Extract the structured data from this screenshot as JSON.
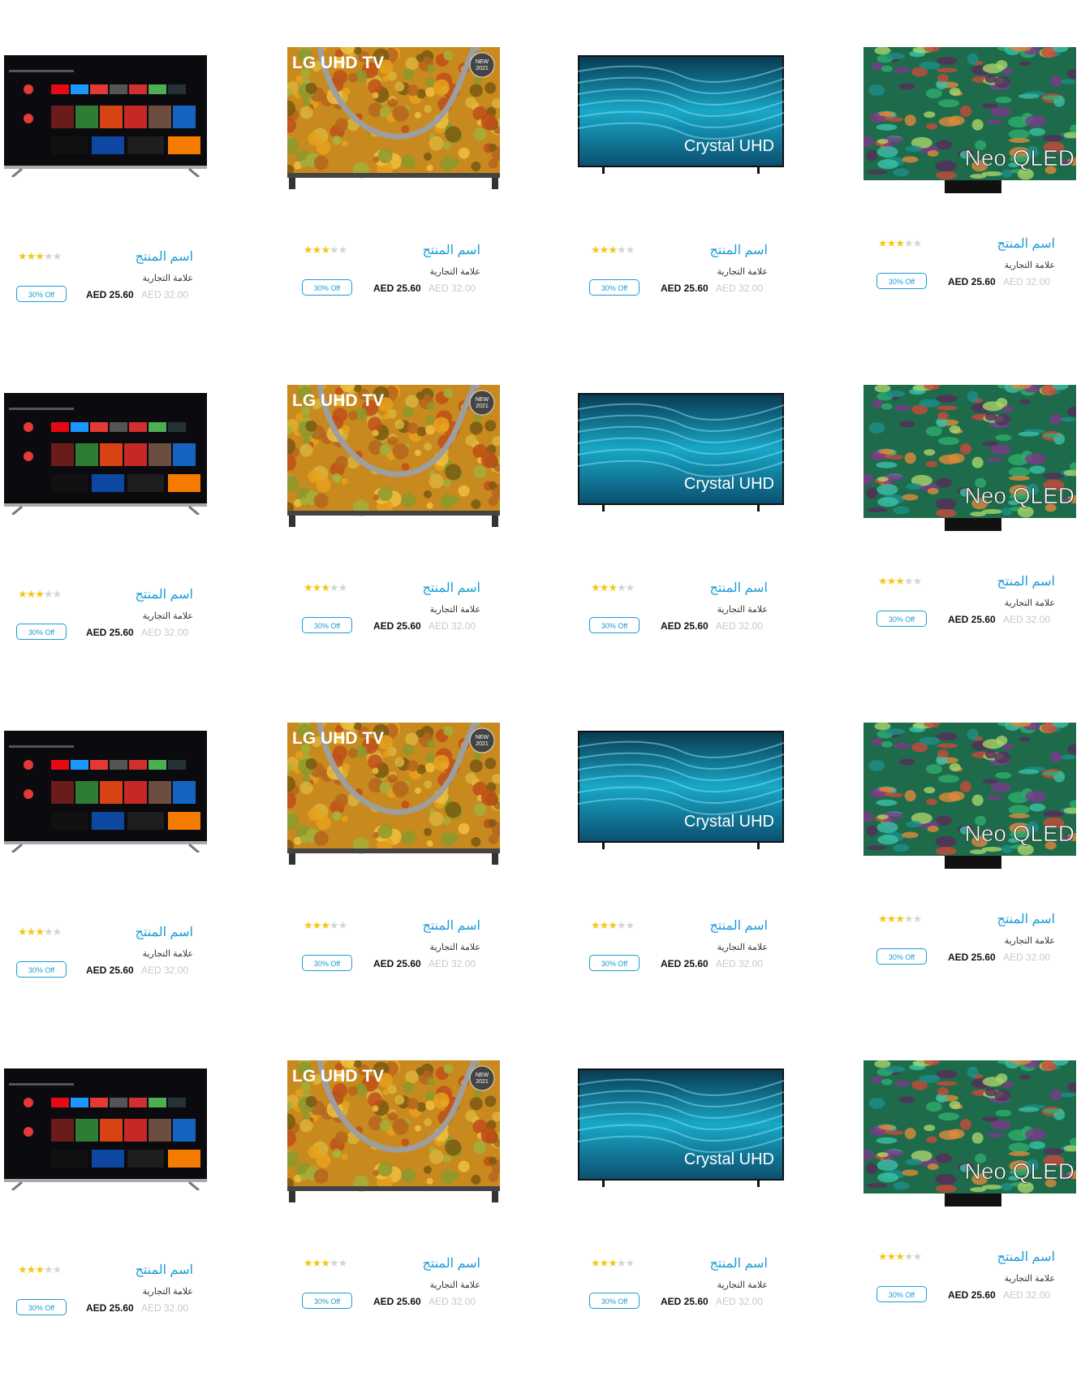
{
  "images": [
    {
      "type": "android-tv",
      "icon": "android-tv-screen-icon"
    },
    {
      "type": "lg-uhd",
      "brand_text": "LG UHD TV",
      "badge_line1": "NEW",
      "badge_line2": "2021",
      "icon": "lg-forest-screen-icon"
    },
    {
      "type": "crystal",
      "brand_text": "Crystal UHD",
      "icon": "crystal-wave-screen-icon"
    },
    {
      "type": "neo",
      "brand_text": "Neo QLED",
      "icon": "neo-abstract-screen-icon"
    }
  ],
  "products": [
    {
      "name": "اسم المنتج",
      "brand": "علامة التجارية",
      "rating": 3,
      "discount": "30% Off",
      "price": "AED 25.60",
      "old_price": "AED 32.00"
    },
    {
      "name": "اسم المنتج",
      "brand": "علامة التجارية",
      "rating": 3,
      "discount": "30% Off",
      "price": "AED 25.60",
      "old_price": "AED 32.00"
    },
    {
      "name": "اسم المنتج",
      "brand": "علامة التجارية",
      "rating": 3,
      "discount": "30% Off",
      "price": "AED 25.60",
      "old_price": "AED 32.00"
    },
    {
      "name": "اسم المنتج",
      "brand": "علامة التجارية",
      "rating": 3,
      "discount": "30% Off",
      "price": "AED 25.60",
      "old_price": "AED 32.00"
    },
    {
      "name": "اسم المنتج",
      "brand": "علامة التجارية",
      "rating": 3,
      "discount": "30% Off",
      "price": "AED 25.60",
      "old_price": "AED 32.00"
    },
    {
      "name": "اسم المنتج",
      "brand": "علامة التجارية",
      "rating": 3,
      "discount": "30% Off",
      "price": "AED 25.60",
      "old_price": "AED 32.00"
    },
    {
      "name": "اسم المنتج",
      "brand": "علامة التجارية",
      "rating": 3,
      "discount": "30% Off",
      "price": "AED 25.60",
      "old_price": "AED 32.00"
    },
    {
      "name": "اسم المنتج",
      "brand": "علامة التجارية",
      "rating": 3,
      "discount": "30% Off",
      "price": "AED 25.60",
      "old_price": "AED 32.00"
    },
    {
      "name": "اسم المنتج",
      "brand": "علامة التجارية",
      "rating": 3,
      "discount": "30% Off",
      "price": "AED 25.60",
      "old_price": "AED 32.00"
    },
    {
      "name": "اسم المنتج",
      "brand": "علامة التجارية",
      "rating": 3,
      "discount": "30% Off",
      "price": "AED 25.60",
      "old_price": "AED 32.00"
    },
    {
      "name": "اسم المنتج",
      "brand": "علامة التجارية",
      "rating": 3,
      "discount": "30% Off",
      "price": "AED 25.60",
      "old_price": "AED 32.00"
    },
    {
      "name": "اسم المنتج",
      "brand": "علامة التجارية",
      "rating": 3,
      "discount": "30% Off",
      "price": "AED 25.60",
      "old_price": "AED 32.00"
    },
    {
      "name": "اسم المنتج",
      "brand": "علامة التجارية",
      "rating": 3,
      "discount": "30% Off",
      "price": "AED 25.60",
      "old_price": "AED 32.00"
    },
    {
      "name": "اسم المنتج",
      "brand": "علامة التجارية",
      "rating": 3,
      "discount": "30% Off",
      "price": "AED 25.60",
      "old_price": "AED 32.00"
    },
    {
      "name": "اسم المنتج",
      "brand": "علامة التجارية",
      "rating": 3,
      "discount": "30% Off",
      "price": "AED 25.60",
      "old_price": "AED 32.00"
    },
    {
      "name": "اسم المنتج",
      "brand": "علامة التجارية",
      "rating": 3,
      "discount": "30% Off",
      "price": "AED 25.60",
      "old_price": "AED 32.00"
    }
  ],
  "colors": {
    "accent": "#1a9bd7",
    "star": "#f5c518",
    "star_empty": "#d4d4d4",
    "old_price": "#c8c8c8"
  },
  "rating_max": 5
}
